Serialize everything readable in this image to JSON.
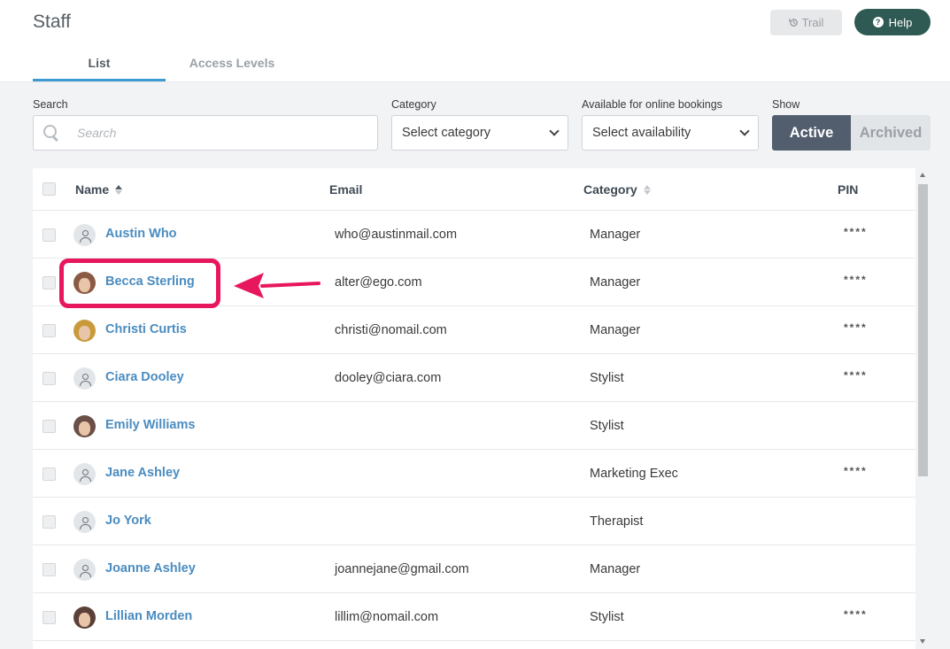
{
  "header": {
    "title": "Staff",
    "trail_label": "Trail",
    "help_label": "Help",
    "tabs": [
      {
        "label": "List",
        "active": true
      },
      {
        "label": "Access Levels",
        "active": false
      }
    ]
  },
  "filters": {
    "search_label": "Search",
    "search_placeholder": "Search",
    "category_label": "Category",
    "category_value": "Select category",
    "availability_label": "Available for online bookings",
    "availability_value": "Select availability",
    "show_label": "Show",
    "show_active": "Active",
    "show_archived": "Archived"
  },
  "table": {
    "columns": {
      "name": "Name",
      "email": "Email",
      "category": "Category",
      "pin": "PIN"
    },
    "rows": [
      {
        "name": "Austin Who",
        "email": "who@austinmail.com",
        "category": "Manager",
        "pin": "****",
        "avatar": "person-icon"
      },
      {
        "name": "Becca Sterling",
        "email": "alter@ego.com",
        "category": "Manager",
        "pin": "****",
        "avatar": "photo"
      },
      {
        "name": "Christi Curtis",
        "email": "christi@nomail.com",
        "category": "Manager",
        "pin": "****",
        "avatar": "photo"
      },
      {
        "name": "Ciara Dooley",
        "email": "dooley@ciara.com",
        "category": "Stylist",
        "pin": "****",
        "avatar": "person-icon"
      },
      {
        "name": "Emily Williams",
        "email": "",
        "category": "Stylist",
        "pin": "",
        "avatar": "photo"
      },
      {
        "name": "Jane Ashley",
        "email": "",
        "category": "Marketing Exec",
        "pin": "****",
        "avatar": "person-icon"
      },
      {
        "name": "Jo York",
        "email": "",
        "category": "Therapist",
        "pin": "",
        "avatar": "person-icon"
      },
      {
        "name": "Joanne Ashley",
        "email": "joannejane@gmail.com",
        "category": "Manager",
        "pin": "",
        "avatar": "person-icon"
      },
      {
        "name": "Lillian Morden",
        "email": "lillim@nomail.com",
        "category": "Stylist",
        "pin": "****",
        "avatar": "photo"
      }
    ]
  },
  "colors": {
    "accent": "#3d9ad1",
    "help_button": "#2f5a54",
    "active_toggle": "#525e6e",
    "name_link": "#4a8cc0",
    "highlight": "#e8175d"
  }
}
